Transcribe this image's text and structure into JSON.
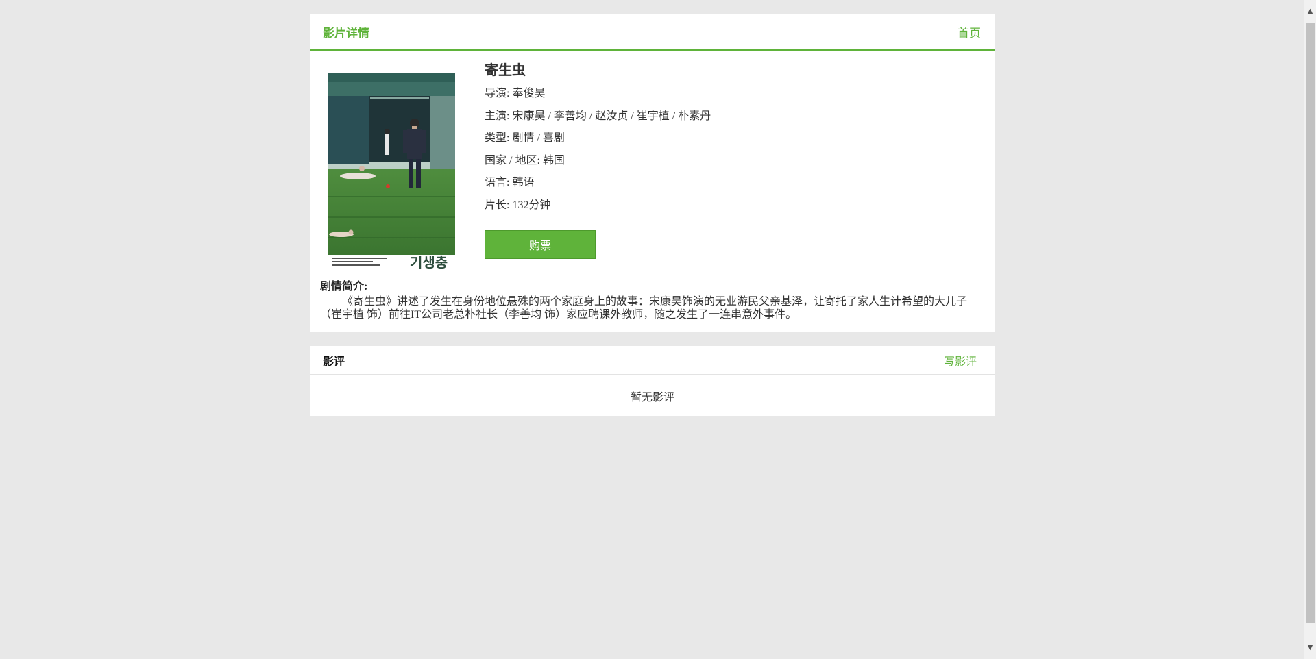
{
  "header": {
    "title": "影片详情",
    "home_link": "首页"
  },
  "movie": {
    "title": "寄生虫",
    "director": "导演: 奉俊昊",
    "cast": "主演: 宋康昊 / 李善均 / 赵汝贞 / 崔宇植 / 朴素丹",
    "genre": "类型: 剧情 / 喜剧",
    "region": "国家 / 地区: 韩国",
    "language": "语言: 韩语",
    "runtime": "片长: 132分钟",
    "buy_label": "购票",
    "poster_text": "기생충"
  },
  "synopsis": {
    "label": "剧情简介:",
    "text": "《寄生虫》讲述了发生在身份地位悬殊的两个家庭身上的故事：宋康昊饰演的无业游民父亲基泽，让寄托了家人生计希望的大儿子（崔宇植 饰）前往IT公司老总朴社长（李善均 饰）家应聘课外教师，随之发生了一连串意外事件。"
  },
  "reviews": {
    "title": "影评",
    "write_link": "写影评",
    "empty_text": "暂无影评"
  },
  "colors": {
    "accent": "#5fb33a",
    "background": "#e8e8e8"
  }
}
